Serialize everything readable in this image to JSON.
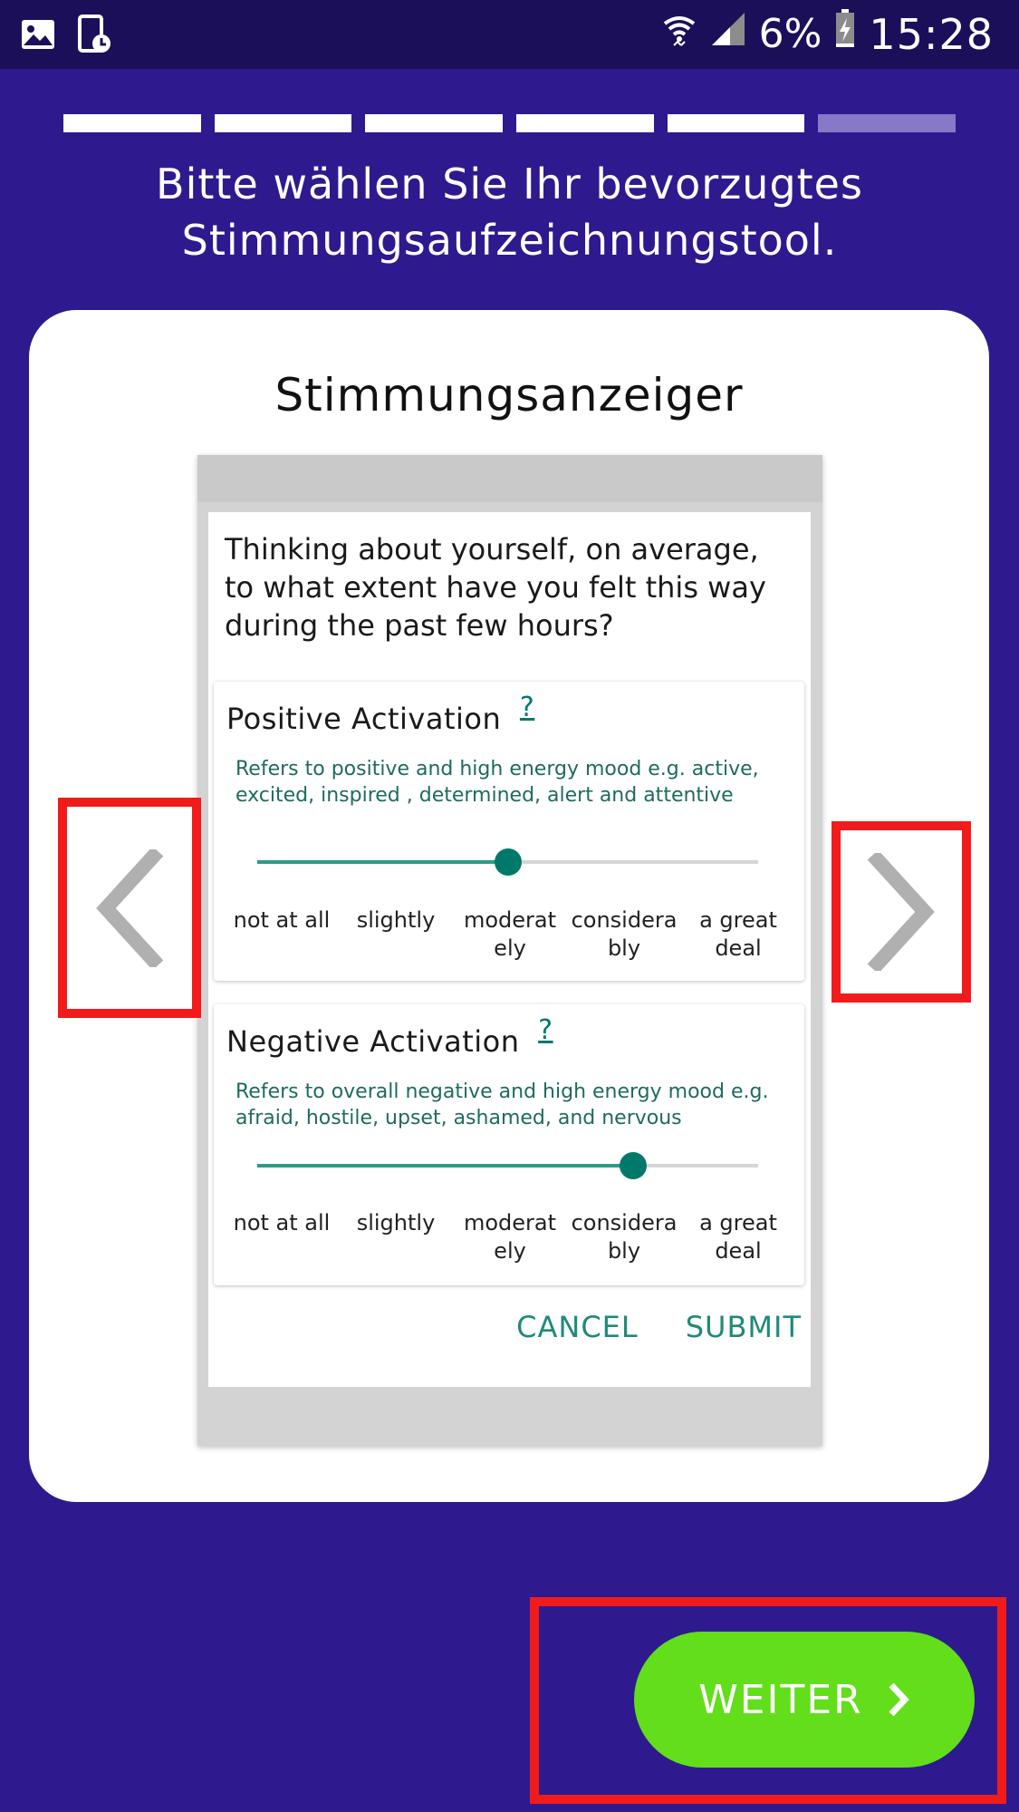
{
  "status_bar": {
    "battery": "6%",
    "time": "15:28",
    "left_icons": [
      "image-icon",
      "screenshot-icon"
    ],
    "right_icons": [
      "wifi-icon",
      "signal-icon",
      "battery-charging-icon"
    ]
  },
  "progress": {
    "total_steps": 6,
    "current_step": 6
  },
  "heading": {
    "line1": "Bitte wählen Sie Ihr bevorzugtes",
    "line2": "Stimmungsaufzeichnungstool."
  },
  "card": {
    "title": "Stimmungsanzeiger",
    "preview": {
      "question": "Thinking about yourself, on average, to what extent have you felt this way during the past few hours?",
      "scale_labels": [
        "not at all",
        "slightly",
        "moderat ely",
        "considera bly",
        "a great deal"
      ],
      "positive": {
        "title": "Positive Activation",
        "help": "?",
        "description": "Refers to positive and high energy mood e.g. active, excited, inspired , determined, alert and attentive",
        "level": "moderat ely",
        "level_percent": 50
      },
      "negative": {
        "title": "Negative Activation",
        "help": "?",
        "description": "Refers to overall negative and high energy mood e.g. afraid, hostile, upset, ashamed, and nervous",
        "level": "considera bly",
        "level_percent": 75
      },
      "cancel_label": "CANCEL",
      "submit_label": "SUBMIT"
    }
  },
  "navigation": {
    "prev_icon": "chevron-left-icon",
    "next_icon": "chevron-right-icon"
  },
  "weiter_button": {
    "label": "WEITER",
    "icon": "chevron-right-icon"
  },
  "colors": {
    "background": "#2e1a8e",
    "status_bar": "#1c0f5a",
    "accent_green": "#62de1a",
    "teal": "#00796b",
    "highlight_red": "#f21b1b"
  }
}
